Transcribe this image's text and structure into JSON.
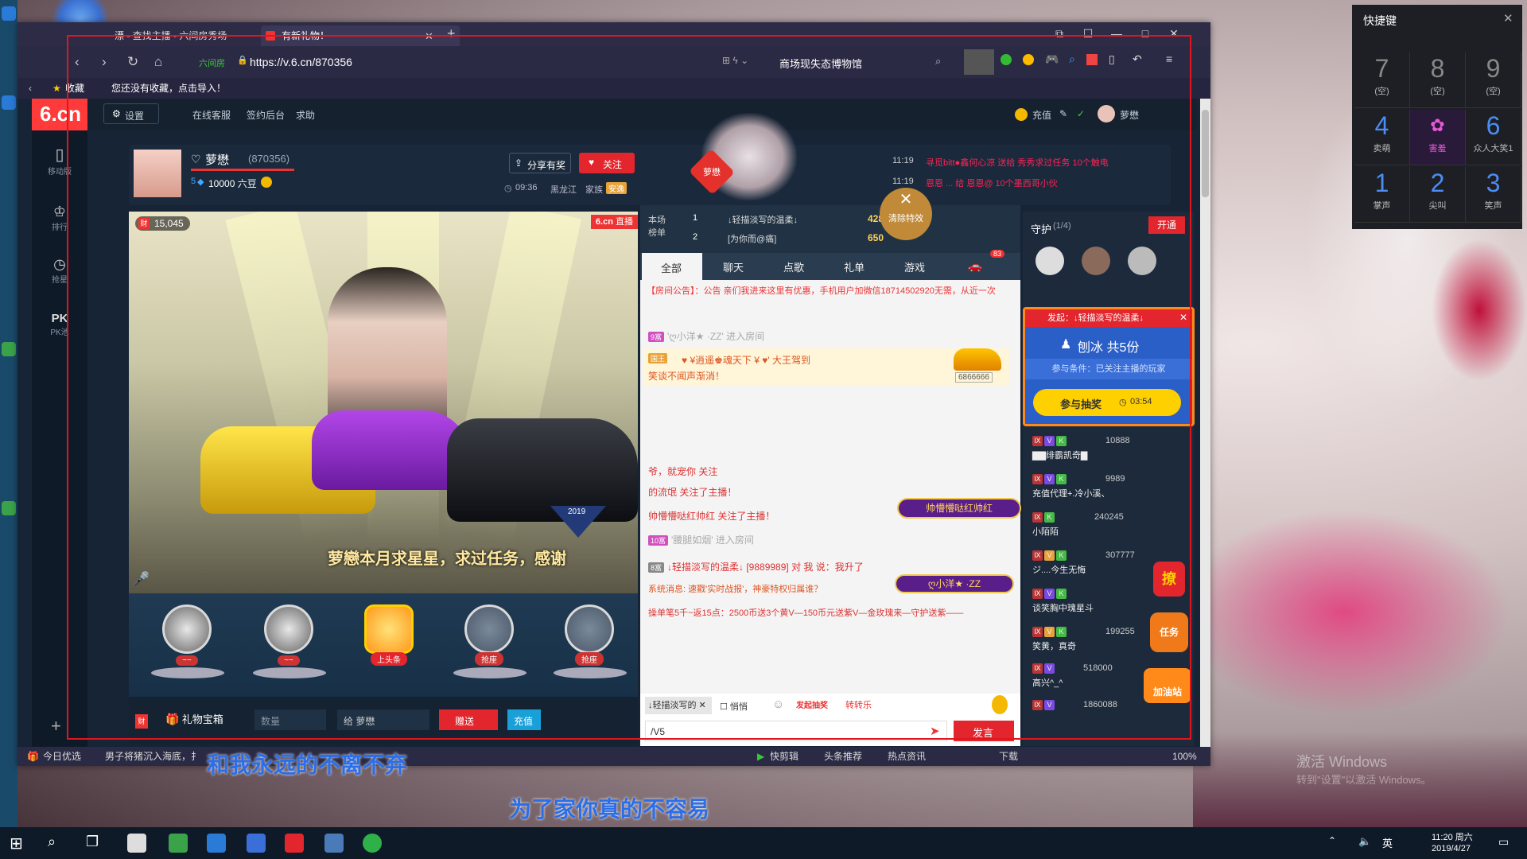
{
  "browser": {
    "tabs": [
      {
        "label": "漂 - 查找主播 - 六间房秀场"
      },
      {
        "label": "有新礼物！"
      }
    ],
    "url": "https://v.6.cn/870356",
    "site_tag": "六间房",
    "search": "商场现失态博物馆",
    "bookmarks": {
      "fav_label": "收藏",
      "hint": "您还没有收藏，点击导入！"
    }
  },
  "site": {
    "logo": "6.cn",
    "logo_sub": "六间房",
    "side": [
      {
        "label": "移动版"
      },
      {
        "label": "排行"
      },
      {
        "label": "抢星"
      },
      {
        "label": "PK池"
      }
    ],
    "top": {
      "settings": "设置",
      "service": "在线客服",
      "sign": "签约后台",
      "help": "求助",
      "recharge": "充值",
      "user": "萝懋"
    },
    "anchor": {
      "name": "萝懋",
      "room": "(870356)",
      "fans": "10000 六豆",
      "level": "5",
      "share": "分享有奖",
      "follow": "关注",
      "time": "09:36",
      "region": "黑龙江",
      "family": "家族",
      "family_tag": "安逸"
    },
    "broadcast": [
      {
        "time": "11:19",
        "text": "寻觅bitt●鑫何心凉 送给 秀秀求过任务 10个触电"
      },
      {
        "time": "11:19",
        "text": "恩恩 ... 给 恩恩@ 10个墨西哥小伙"
      }
    ],
    "clear_effects": "清除特效",
    "video": {
      "viewers": "15,045",
      "live_tag": "直播",
      "brand": "6.cn",
      "subtitle": "萝戀本月求星星，求过任务，感谢",
      "car_label": "帅懵懵哒红帅红",
      "year": "2019"
    },
    "seats": [
      {
        "label": "~~"
      },
      {
        "label": "~~"
      },
      {
        "label": "上头条"
      },
      {
        "label": "抢座"
      },
      {
        "label": "抢座"
      }
    ],
    "giftbar": {
      "box": "礼物宝箱",
      "qty_placeholder": "数量",
      "to": "给 萝懋",
      "send": "赠送",
      "recharge": "充值"
    },
    "rank": {
      "title": "本场榜单",
      "rows": [
        {
          "rank": "1",
          "name": "↓轻描淡写的温柔↓",
          "score": "42872"
        },
        {
          "rank": "2",
          "name": "[为你而@痛]",
          "score": "650"
        }
      ]
    },
    "chat_tabs": [
      "全部",
      "聊天",
      "点歌",
      "礼单",
      "游戏"
    ],
    "car_count": "83",
    "chat": [
      {
        "type": "notice",
        "text": "【房间公告】：公告 亲们我进来这里有优惠，手机用户加微信18714502920无需，从近一次"
      },
      {
        "type": "enter",
        "level": "9富",
        "text": "'ღ小洋★ ·ZZ' 进入房间"
      },
      {
        "type": "vip",
        "level": "国王",
        "text": "♥ ¥逍遥♚魂天下 ¥ ♥' 大王驾到",
        "sub": "笑谈不闻声渐消！",
        "car_id": "6866666"
      },
      {
        "type": "plain",
        "text": "爷，就宠你 关注"
      },
      {
        "type": "plain",
        "text": "的流氓 关注了主播！"
      },
      {
        "type": "plain",
        "text": "帅懵懵哒红帅红 关注了主播！"
      },
      {
        "type": "enter",
        "level": "10富",
        "text": "'腰腿如烟' 进入房间"
      },
      {
        "type": "say",
        "level": "8富",
        "text": "↓轻描淡写的温柔↓ [9889989] 对 我 说：我升了"
      },
      {
        "type": "sys",
        "text": "系统消息: 速戳'实时战报'，神豪特权归属谁？"
      },
      {
        "type": "promo",
        "text": "操单笔5千~返15点：2500币送3个黄V—150币元送紫V—金玫瑰来—守护送紫——"
      }
    ],
    "chat_badge": "ღ小洋★ ·ZZ",
    "chat_input": {
      "target": "↓轻描淡写的",
      "whisper": "悄悄",
      "value": "/V5",
      "send": "发言",
      "mini_game": "转转乐",
      "task": "发起抽奖"
    },
    "guard": {
      "title": "守护",
      "count": "(1/4)",
      "open": "开通"
    },
    "lottery": {
      "starter": "发起：↓轻描淡写的温柔↓",
      "prize": "刨冰 共5份",
      "cond": "参与条件：已关注主播的玩家",
      "btn": "参与抽奖",
      "timer": "03:54"
    },
    "users": [
      {
        "id": "870356",
        "name": "萝懋"
      },
      {
        "id": "10888",
        "name": "▇▇绯霸凯奇▇"
      },
      {
        "id": "9989",
        "name": "充值代理+.冷小溪、"
      },
      {
        "id": "240245",
        "name": "小陌陌"
      },
      {
        "id": "307777",
        "name": "ジ....今生无悔"
      },
      {
        "id": "",
        "name": "谈笑胸中瑰星斗"
      },
      {
        "id": "199255",
        "name": "笑黄，真奇"
      },
      {
        "id": "518000",
        "name": "高兴^_^"
      },
      {
        "id": "1860088",
        "name": "..."
      }
    ],
    "float_labels": {
      "task": "任务",
      "refuel": "加油站",
      "liao": "撩"
    }
  },
  "status": {
    "left": "今日优选",
    "news": "男子将猪沉入海底，扌",
    "kuai": "快剪辑",
    "toutiao": "头条推荐",
    "hot": "热点资讯",
    "download": "下载",
    "zoom": "100%"
  },
  "overlay_subtitles": {
    "line1": "和我永远的不离不弃",
    "line2": "为了家你真的不容易"
  },
  "hotkeys": {
    "title": "快捷键",
    "cells": [
      {
        "num": "7",
        "label": "(空)"
      },
      {
        "num": "8",
        "label": "(空)"
      },
      {
        "num": "9",
        "label": "(空)"
      },
      {
        "num": "4",
        "label": "卖萌"
      },
      {
        "num": "",
        "label": "害羞"
      },
      {
        "num": "6",
        "label": "众人大笑1"
      },
      {
        "num": "1",
        "label": "掌声"
      },
      {
        "num": "2",
        "label": "尖叫"
      },
      {
        "num": "3",
        "label": "笑声"
      }
    ]
  },
  "watermark": {
    "line1": "激活 Windows",
    "line2": "转到\"设置\"以激活 Windows。"
  },
  "taskbar": {
    "ime": "英",
    "time": "11:20 周六",
    "date": "2019/4/27"
  }
}
